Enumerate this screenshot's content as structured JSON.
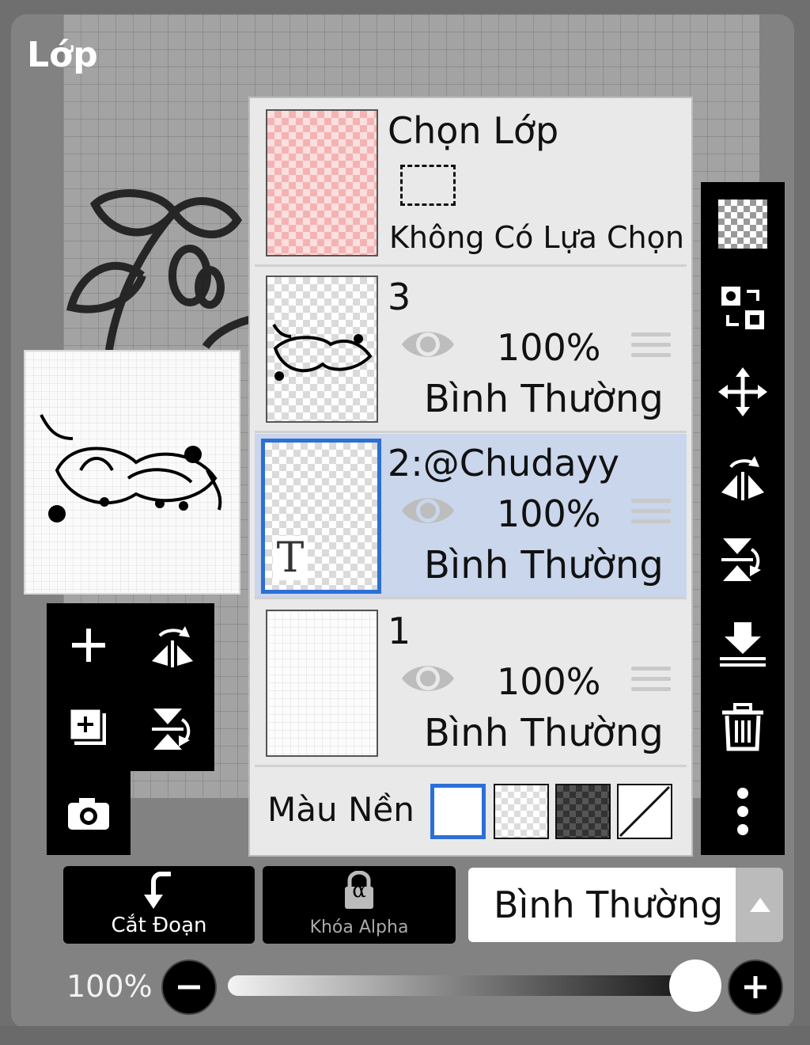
{
  "panel": {
    "title": "Lớp"
  },
  "selection_row": {
    "title": "Chọn Lớp",
    "status": "Không Có Lựa Chọn"
  },
  "layers": [
    {
      "name": "3",
      "opacity": "100%",
      "blend": "Bình Thường",
      "selected": false
    },
    {
      "name": "2:@Chudayy",
      "opacity": "100%",
      "blend": "Bình Thường",
      "selected": true
    },
    {
      "name": "1",
      "opacity": "100%",
      "blend": "Bình Thường",
      "selected": false
    }
  ],
  "background": {
    "label": "Màu Nền",
    "swatches": [
      "white",
      "transparent",
      "dark-checker",
      "none"
    ],
    "selected": "white"
  },
  "layer_text_marker": "T",
  "buttons": {
    "clipping": "Cắt Đoạn",
    "alpha_lock": "Khóa Alpha",
    "alpha_symbol": "α"
  },
  "blend_mode": {
    "value": "Bình Thường"
  },
  "opacity_slider": {
    "label": "100%",
    "value": 1.0
  },
  "icons": {
    "left_tools": [
      "add-icon",
      "flip-horizontal-icon",
      "add-copy-icon",
      "flip-vertical-icon",
      "camera-icon"
    ],
    "right_tools": [
      "transparency-icon",
      "swap-icon",
      "move-icon",
      "flip-horizontal-icon",
      "flip-vertical-icon",
      "merge-down-icon",
      "trash-icon",
      "more-icon"
    ]
  },
  "colors": {
    "selected_layer": "#c9d6eb",
    "selection_border": "#2d6fd6",
    "toolbar": "#000000"
  }
}
